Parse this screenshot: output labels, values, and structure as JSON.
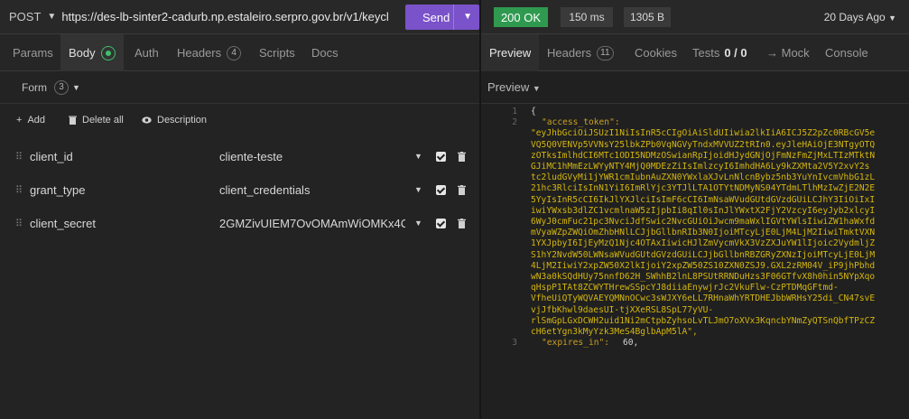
{
  "request": {
    "method": "POST",
    "url": "https://des-lb-sinter2-cadurb.np.estaleiro.serpro.gov.br/v1/keycloak",
    "send_label": "Send"
  },
  "request_tabs": [
    {
      "label": "Params"
    },
    {
      "label": "Body"
    },
    {
      "label": "Auth"
    },
    {
      "label": "Headers",
      "count": "4"
    },
    {
      "label": "Scripts"
    },
    {
      "label": "Docs"
    }
  ],
  "body": {
    "type_label": "Form",
    "type_count": "3",
    "add_label": "Add",
    "delete_all_label": "Delete all",
    "description_label": "Description",
    "params": [
      {
        "name": "client_id",
        "value": "cliente-teste"
      },
      {
        "name": "grant_type",
        "value": "client_credentials"
      },
      {
        "name": "client_secret",
        "value": "2GMZivUIEM7OvOMAmWiOMKx4C"
      }
    ]
  },
  "response": {
    "status": "200 OK",
    "time": "150 ms",
    "size": "1305 B",
    "age": "20 Days Ago"
  },
  "response_tabs": {
    "preview": "Preview",
    "headers": "Headers",
    "headers_count": "11",
    "cookies": "Cookies",
    "tests": "Tests",
    "tests_count": "0 / 0",
    "mock": "→ Mock",
    "console": "Console"
  },
  "preview_label": "Preview",
  "code": {
    "line1_no": "1",
    "line2_no": "2",
    "line3_no": "3",
    "open_brace": "{",
    "key_access_token": "\"access_token\":",
    "token_lines": [
      "\"eyJhbGciOiJSUzI1NiIsInR5cCIgOiAiSldUIiwia2lkIiA6ICJ5Z2pZc0RBcGV5e",
      "VQ5Q0VENVp5VVNsY25lbkZPb0VqNGVyTndxMVVUZ2tRIn0.eyJleHAiOjE3NTgyOTQ",
      "zOTksImlhdCI6MTc1ODI5NDMzOSwianRpIjoidHJydGNjOjFmNzFmZjMxLTIzMTktN",
      "GJiMC1hMmEzLWYyNTY4MjQ0MDEzZiIsImlzcyI6ImhdHA6Ly9kZXMta2V5Y2xvY2s",
      "tc2ludGVyMi1jYWR1cmIubnAuZXN0YWxlaXJvLnNlcnBybz5nb3YuYnIvcmVhbG1zL",
      "21hc3RlciIsInN1YiI6ImRlYjc3YTJlLTA1OTYtNDMyNS04YTdmLTlhMzIwZjE2N2E",
      "5YyIsInR5cCI6IkJlYXJlciIsImF6cCI6ImNsaWVudGUtdGVzdGUiLCJhY3IiOiIxI",
      "iwiYWxsb3dlZC1vcmlnaW5zIjpbIi8qIl0sInJlYWxtX2FjY2VzcyI6eyJyb2xlcyI",
      "6WyJ0cmFuc21pc3NvciJdfSwic2NvcGUiOiJwcm9maWxlIGVtYWlsIiwiZW1haWxfd",
      "mVyaWZpZWQiOmZhbHNlLCJjbGllbnRIb3N0IjoiMTcyLjE0LjM4LjM2IiwiTmktVXN",
      "1YXJpbyI6IjEyMzQ1Njc4OTAxIiwicHJlZmVycmVkX3VzZXJuYW1lIjoic2VydmljZ",
      "S1hY2NvdW50LWNsaWVudGUtdGVzdGUiLCJjbGllbnRBZGRyZXNzIjoiMTcyLjE0LjM",
      "4LjM2IiwiY2xpZW50X2lkIjoiY2xpZW50ZS10ZXN0ZSJ9.GXL2zRM04V_iP9jhPbhd",
      "wN3a0kSQdHUy75nnfD62H_SWhhB2lnL8PSUtRRNDuHzs3F06GTfvX8h0hin5NYpXqo",
      "qHspP1TAt8ZCWYTHrewSSpcYJ8diiaEnywjrJc2VkuFlw-CzPTDMqGFtmd-",
      "VfheUiQTyWQVAEYQMNnOCwc3sWJXY6eLL7RHnaWhYRTDHEJbbWRHsY25di_CN47svE",
      "vjJfbKhwl9daesUI-tjXXeRSL8SpL77yVU-",
      "rlSmGpLGxDCWH2uid1Ni2mCtpbZyhsoLvTLJmO7oXVx3KqncbYNmZyQTSnQbfTPzCZ",
      "cH6etYgn3kMyYzk3MeS4BglbApM5lA\","
    ],
    "key_expires_in": "\"expires_in\":",
    "expires_value": "60,"
  }
}
